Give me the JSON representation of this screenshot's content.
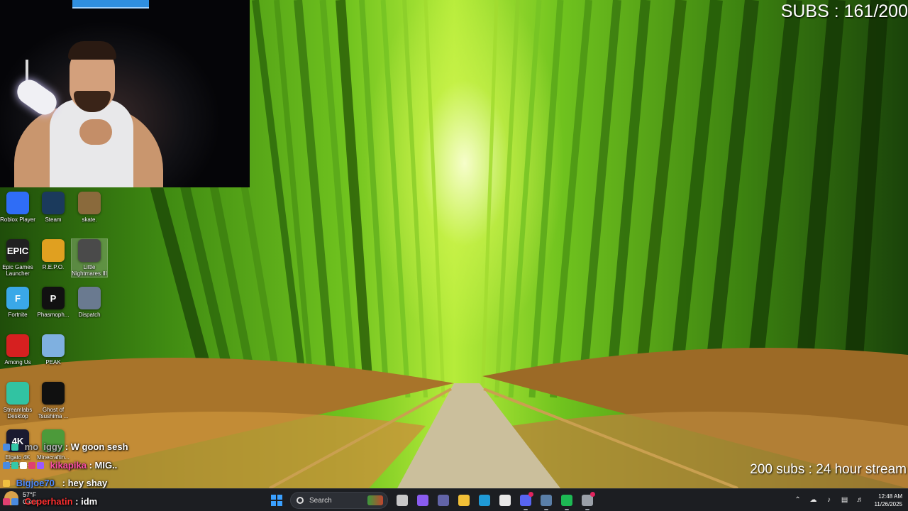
{
  "overlay": {
    "subs_counter": "SUBS : 161/200",
    "stream_goal": "200 subs : 24 hour stream"
  },
  "desktop": {
    "icons": [
      {
        "label": "Roblox Player",
        "icon": "roblox-icon",
        "color": "#2f6df6"
      },
      {
        "label": "Steam",
        "icon": "steam-icon",
        "color": "#1b3a5c"
      },
      {
        "label": "skate.",
        "icon": "skate-icon",
        "color": "#8a6a3c"
      },
      {
        "label": "Epic Games Launcher",
        "icon": "epic-games-icon",
        "color": "#202020",
        "glyph": "EPIC"
      },
      {
        "label": "R.E.P.O.",
        "icon": "repo-icon",
        "color": "#e0a020"
      },
      {
        "label": "Little Nightmares III",
        "icon": "little-nightmares-icon",
        "color": "#4a4a4a"
      },
      {
        "label": "Fortnite",
        "icon": "fortnite-icon",
        "color": "#3aa8e8",
        "glyph": "F"
      },
      {
        "label": "Phasmoph...",
        "icon": "phasmophobia-icon",
        "color": "#111111",
        "glyph": "P"
      },
      {
        "label": "Dispatch",
        "icon": "dispatch-icon",
        "color": "#6a7a90"
      },
      {
        "label": "Among Us",
        "icon": "among-us-icon",
        "color": "#d62020"
      },
      {
        "label": "PEAK",
        "icon": "peak-icon",
        "color": "#7fb0e0"
      },
      {
        "label": "Streamlabs Desktop",
        "icon": "streamlabs-icon",
        "color": "#31c3a2"
      },
      {
        "label": "Ghost of Tsushima ...",
        "icon": "ghost-of-tsushima-icon",
        "color": "#101010"
      },
      {
        "label": "Elgato 4K Capture...",
        "icon": "elgato-4k-icon",
        "color": "#1a1a30",
        "glyph": "4K"
      },
      {
        "label": "Minecraftin...",
        "icon": "minecraft-icon",
        "color": "#4c9a3a"
      }
    ]
  },
  "chat": {
    "messages": [
      {
        "user": "mo_iggy",
        "text": " : W goon sesh",
        "color": "#b0b0b0"
      },
      {
        "user": "kikapika",
        "text": " : MIG..",
        "color": "#ff4fa8"
      },
      {
        "user": "Bigjoe70_",
        "text": " : hey shay",
        "color": "#4f8cff"
      },
      {
        "user": "Ceperhatin",
        "text": " : idm",
        "color": "#ff3030"
      }
    ]
  },
  "taskbar": {
    "weather": {
      "temp": "57°F",
      "condition": "Clear",
      "icon": "moon-weather-icon"
    },
    "search_placeholder": "Search",
    "pinned": [
      {
        "name": "task-view-icon",
        "color": "#c8c8c8",
        "running": false
      },
      {
        "name": "copilot-icon",
        "color": "#8a5cf0",
        "running": false
      },
      {
        "name": "teams-icon",
        "color": "#6264a7",
        "running": false
      },
      {
        "name": "file-explorer-icon",
        "color": "#f2c037",
        "running": false
      },
      {
        "name": "edge-icon",
        "color": "#1f9ad6",
        "running": false
      },
      {
        "name": "microsoft-store-icon",
        "color": "#e8e8e8",
        "running": false
      },
      {
        "name": "discord-icon",
        "color": "#5865f2",
        "running": true,
        "badge": true
      },
      {
        "name": "steam-taskbar-icon",
        "color": "#5a7fa8",
        "running": true
      },
      {
        "name": "spotify-icon",
        "color": "#1db954",
        "running": true
      },
      {
        "name": "chrome-recording-icon",
        "color": "#9aa0a8",
        "running": true,
        "badge": true
      }
    ],
    "clock": {
      "time": "12:48 AM",
      "date": "11/26/2025"
    }
  }
}
